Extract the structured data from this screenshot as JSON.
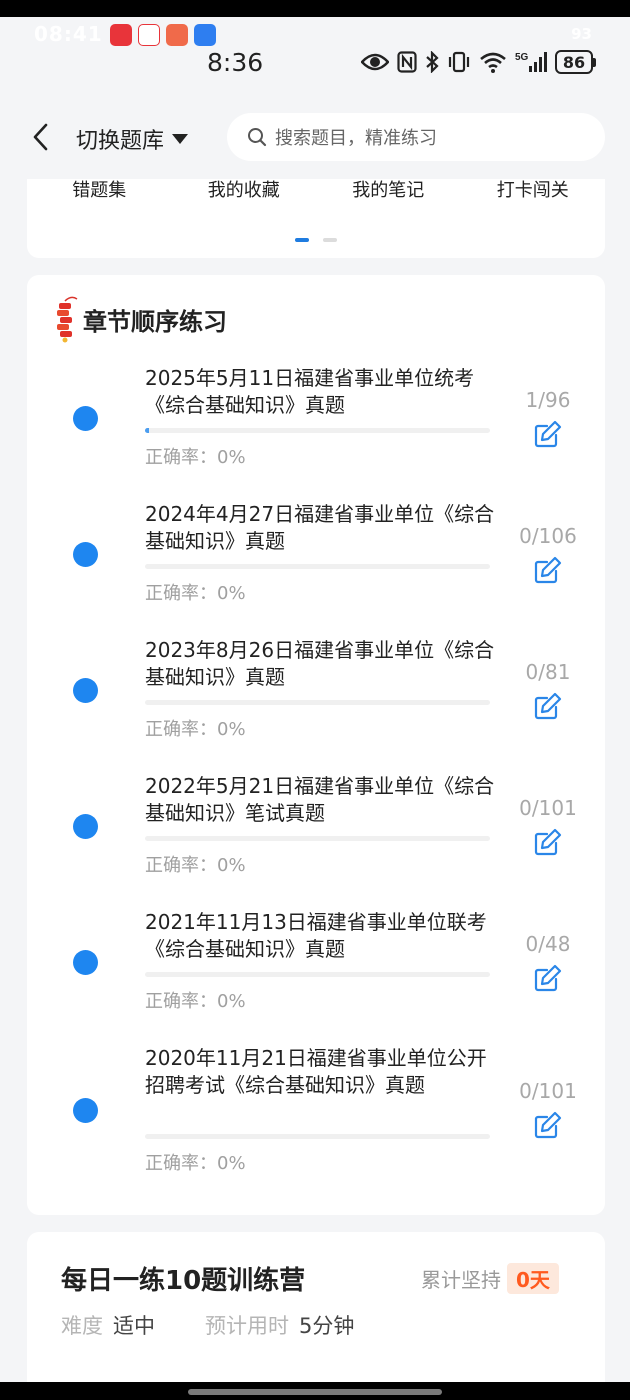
{
  "status_bar": {
    "ghost_time": "08:41",
    "time": "8:36",
    "ghost_battery": "93",
    "battery": "86",
    "signal_label": "5G",
    "icons": [
      "eye-icon",
      "nfc-icon",
      "bluetooth-icon",
      "vibrate-icon",
      "wifi-icon",
      "signal-icon",
      "battery-icon"
    ]
  },
  "header": {
    "switch_label": "切换题库",
    "search_placeholder": "搜索题目，精准练习"
  },
  "top_nav": {
    "items": [
      {
        "label": "错题集"
      },
      {
        "label": "我的收藏"
      },
      {
        "label": "我的笔记"
      },
      {
        "label": "打卡闯关"
      }
    ],
    "page_index": 1,
    "page_count": 2
  },
  "chapter_section": {
    "title": "章节顺序练习",
    "items": [
      {
        "title": "2025年5月11日福建省事业单位统考《综合基础知识》真题",
        "count": "1/96",
        "rate": "正确率：0%",
        "progress": 0.0104
      },
      {
        "title": "2024年4月27日福建省事业单位《综合基础知识》真题",
        "count": "0/106",
        "rate": "正确率：0%",
        "progress": 0
      },
      {
        "title": "2023年8月26日福建省事业单位《综合基础知识》真题",
        "count": "0/81",
        "rate": "正确率：0%",
        "progress": 0
      },
      {
        "title": "2022年5月21日福建省事业单位《综合基础知识》笔试真题",
        "count": "0/101",
        "rate": "正确率：0%",
        "progress": 0
      },
      {
        "title": "2021年11月13日福建省事业单位联考《综合基础知识》真题",
        "count": "0/48",
        "rate": "正确率：0%",
        "progress": 0
      },
      {
        "title": "2020年11月21日福建省事业单位公开招聘考试《综合基础知识》真题",
        "count": "0/101",
        "rate": "正确率：0%",
        "progress": 0
      }
    ]
  },
  "camp": {
    "title": "每日一练10题训练营",
    "streak_label": "累计坚持",
    "streak_value": "0天",
    "difficulty_label": "难度",
    "difficulty_value": "适中",
    "time_label": "预计用时",
    "time_value": "5分钟"
  },
  "colors": {
    "accent": "#1e86f0",
    "streak": "#ff5a1f",
    "background": "#f4f5f7"
  }
}
